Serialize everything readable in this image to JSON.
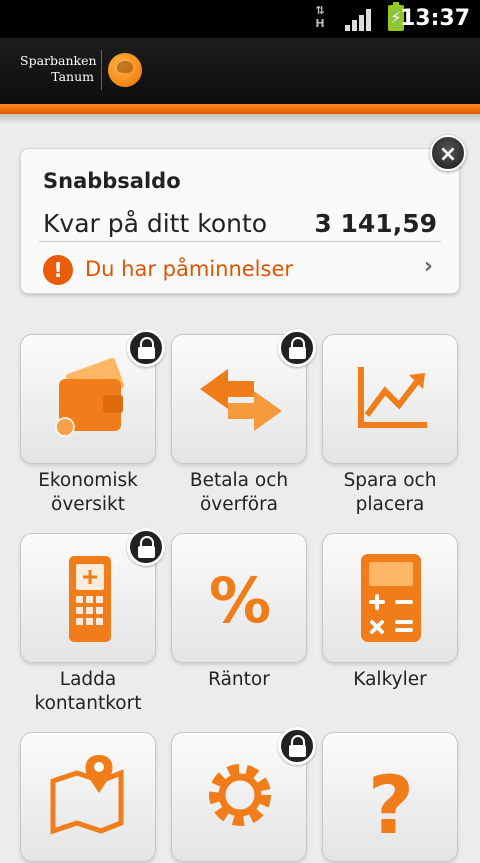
{
  "status_bar": {
    "time": "13:37",
    "network_type": "H"
  },
  "header": {
    "brand_line1": "Sparbanken",
    "brand_line2": "Tanum"
  },
  "quick_balance": {
    "title": "Snabbsaldo",
    "account_label": "Kvar på ditt konto",
    "amount": "3 141,59",
    "reminder_text": "Du har påminnelser",
    "reminder_icon": "!",
    "close_symbol": "×",
    "chevron": "›"
  },
  "menu": [
    {
      "label_line1": "Ekonomisk",
      "label_line2": "översikt",
      "icon": "wallet-icon",
      "locked": true
    },
    {
      "label_line1": "Betala och",
      "label_line2": "överföra",
      "icon": "transfer-arrows-icon",
      "locked": true
    },
    {
      "label_line1": "Spara och",
      "label_line2": "placera",
      "icon": "growth-chart-icon",
      "locked": false
    },
    {
      "label_line1": "Ladda",
      "label_line2": "kontantkort",
      "icon": "phone-keypad-icon",
      "locked": true
    },
    {
      "label_line1": "Räntor",
      "label_line2": "",
      "icon": "percent-icon",
      "locked": false
    },
    {
      "label_line1": "Kalkyler",
      "label_line2": "",
      "icon": "calculator-icon",
      "locked": false
    },
    {
      "label_line1": "",
      "label_line2": "",
      "icon": "map-pin-icon",
      "locked": false
    },
    {
      "label_line1": "",
      "label_line2": "",
      "icon": "gear-icon",
      "locked": true
    },
    {
      "label_line1": "",
      "label_line2": "",
      "icon": "help-icon",
      "locked": false
    }
  ],
  "colors": {
    "accent": "#f07d1a",
    "warning": "#ea5b0c",
    "header_bg": "#141414"
  }
}
